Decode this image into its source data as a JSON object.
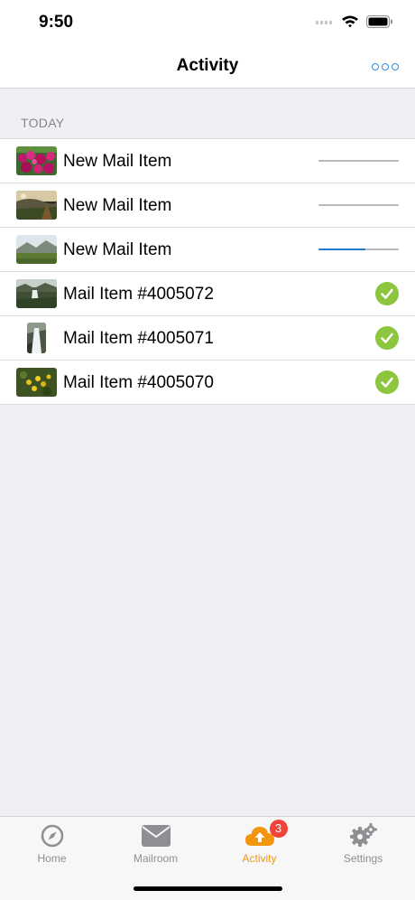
{
  "status_bar": {
    "time": "9:50"
  },
  "nav": {
    "title": "Activity",
    "more_icon": "ellipsis-circles-icon"
  },
  "section": {
    "title": "TODAY"
  },
  "rows": [
    {
      "title": "New Mail Item",
      "state": "uploading",
      "progress": 0.0,
      "thumbnail": "magenta-flowers-photo"
    },
    {
      "title": "New Mail Item",
      "state": "uploading",
      "progress": 0.0,
      "thumbnail": "hillside-sunset-photo"
    },
    {
      "title": "New Mail Item",
      "state": "uploading",
      "progress": 0.58,
      "thumbnail": "mountain-field-photo"
    },
    {
      "title": "Mail Item #4005072",
      "state": "done",
      "thumbnail": "waterfall-valley-photo"
    },
    {
      "title": "Mail Item #4005071",
      "state": "done",
      "thumbnail": "waterfall-portrait-photo"
    },
    {
      "title": "Mail Item #4005070",
      "state": "done",
      "thumbnail": "yellow-flowers-photo"
    }
  ],
  "tabs": [
    {
      "label": "Home",
      "icon": "compass-icon",
      "active": false
    },
    {
      "label": "Mailroom",
      "icon": "envelope-icon",
      "active": false
    },
    {
      "label": "Activity",
      "icon": "cloud-upload-icon",
      "active": true,
      "badge": "3"
    },
    {
      "label": "Settings",
      "icon": "gears-icon",
      "active": false
    }
  ],
  "colors": {
    "accent": "#f4960d",
    "link": "#2f8de0",
    "progress": "#1f7ad0",
    "check": "#8cc63e",
    "badge": "#f0443a"
  }
}
